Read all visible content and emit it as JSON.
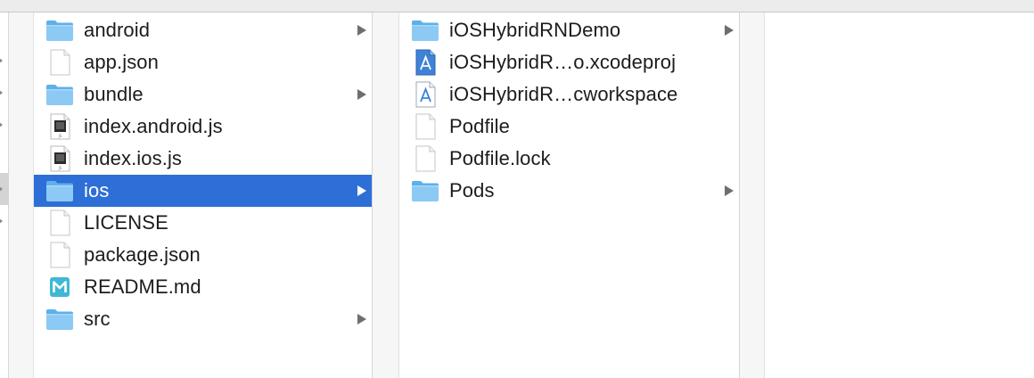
{
  "colors": {
    "selection": "#2d6fd6",
    "folder_light": "#8cc9f4",
    "folder_dark": "#5eb0ea",
    "markdown_icon": "#3fb8d6"
  },
  "column_root": {
    "items": [
      {
        "label": "android",
        "icon": "folder-icon",
        "has_children": true
      },
      {
        "label": "app.json",
        "icon": "document-icon",
        "has_children": false
      },
      {
        "label": "bundle",
        "icon": "folder-icon",
        "has_children": true
      },
      {
        "label": "index.android.js",
        "icon": "js-file-icon",
        "has_children": false
      },
      {
        "label": "index.ios.js",
        "icon": "js-file-icon",
        "has_children": false
      },
      {
        "label": "ios",
        "icon": "folder-icon",
        "has_children": true,
        "selected": true
      },
      {
        "label": "LICENSE",
        "icon": "document-icon",
        "has_children": false
      },
      {
        "label": "package.json",
        "icon": "document-icon",
        "has_children": false
      },
      {
        "label": "README.md",
        "icon": "markdown-icon",
        "has_children": false
      },
      {
        "label": "src",
        "icon": "folder-icon",
        "has_children": true
      }
    ]
  },
  "column_ios": {
    "items": [
      {
        "label": "iOSHybridRNDemo",
        "icon": "folder-icon",
        "has_children": true
      },
      {
        "label": "iOSHybridR…o.xcodeproj",
        "icon": "xcodeproj-icon",
        "has_children": false
      },
      {
        "label": "iOSHybridR…cworkspace",
        "icon": "xcworkspace-icon",
        "has_children": false
      },
      {
        "label": "Podfile",
        "icon": "document-icon",
        "has_children": false
      },
      {
        "label": "Podfile.lock",
        "icon": "document-icon",
        "has_children": false
      },
      {
        "label": "Pods",
        "icon": "folder-icon",
        "has_children": true
      }
    ]
  }
}
